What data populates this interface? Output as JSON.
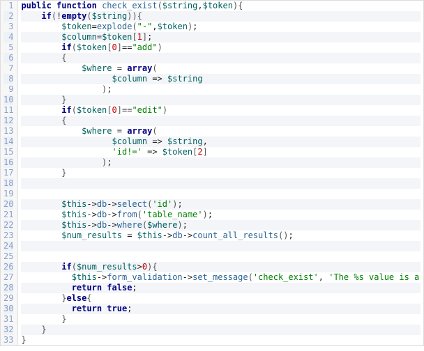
{
  "code": {
    "lines": [
      "public function check_exist($string,$token){",
      "    if(!empty($string)){",
      "        $token=explode(\"-\",$token);",
      "        $column=$token[1];",
      "        if($token[0]==\"add\")",
      "        {",
      "            $where = array(",
      "                  $column => $string",
      "                );",
      "        }",
      "        if($token[0]==\"edit\")",
      "        {",
      "            $where = array(",
      "                  $column => $string,",
      "                  'id!=' => $token[2]",
      "                );",
      "        }",
      "",
      "",
      "        $this->db->select('id');",
      "        $this->db->from('table_name');",
      "        $this->db->where($where);",
      "        $num_results = $this->db->count_all_results();",
      "",
      "",
      "        if($num_results>0){",
      "          $this->form_validation->set_message('check_exist', 'The %s value is a",
      "          return false;",
      "        }else{",
      "          return true;",
      "        }",
      "    }",
      "}"
    ]
  },
  "colors": {
    "keyword": "#000080",
    "variable": "#006060",
    "string": "#008000",
    "number": "#c00000",
    "call": "#2a6496",
    "gutter_text": "#8aa0c8",
    "row_even_bg": "#f3f5f8",
    "row_odd_bg": "#ffffff"
  }
}
